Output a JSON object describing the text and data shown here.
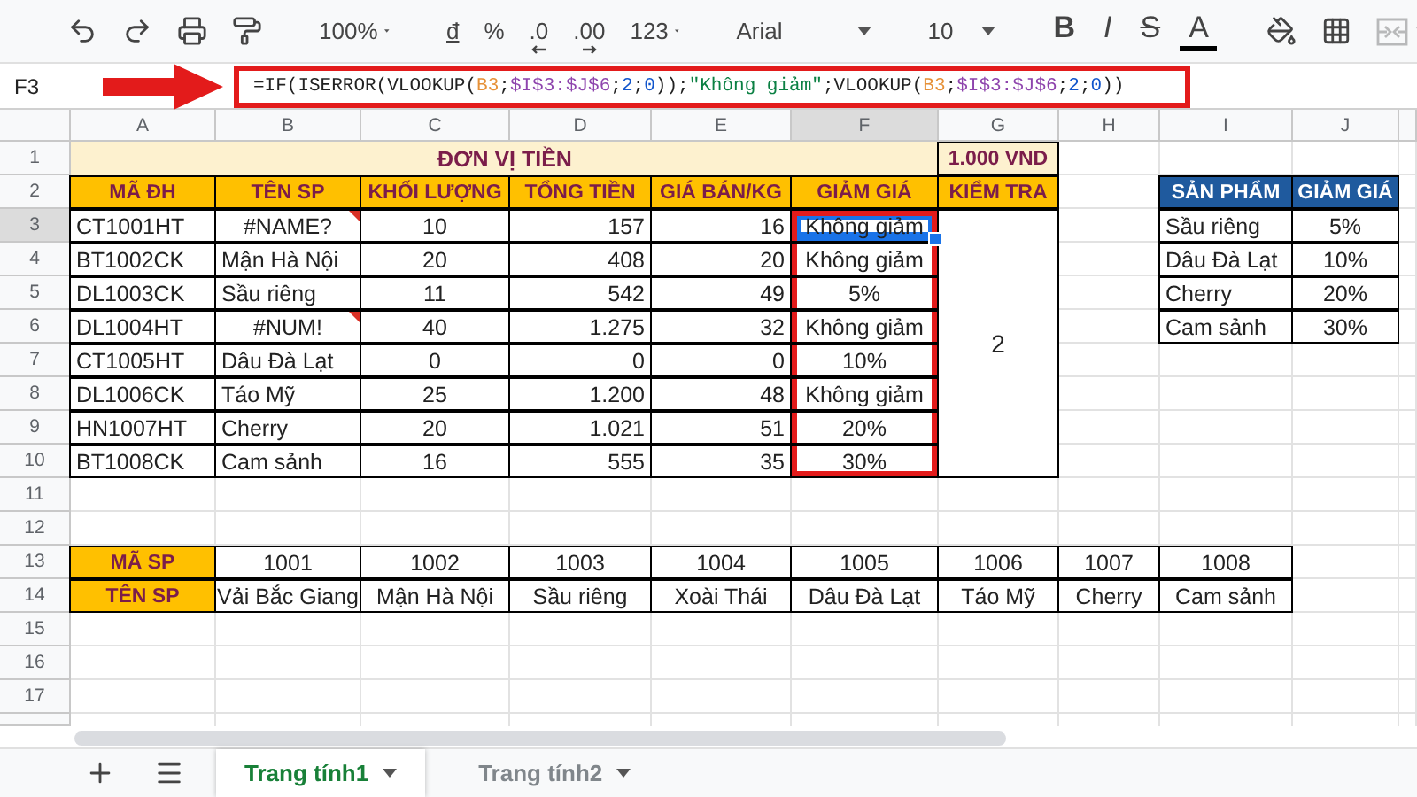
{
  "toolbar": {
    "zoom": "100%",
    "number_formats": [
      "đ",
      "%",
      ".0",
      ".00"
    ],
    "more_formats": "123",
    "font": "Arial",
    "font_size": "10",
    "text_styles": [
      "B",
      "I",
      "S",
      "A"
    ],
    "merge_disabled": true
  },
  "formula_bar": {
    "cell_ref": "F3",
    "formula": [
      {
        "kind": "text",
        "text": "=IF(ISERROR(VLOOKUP("
      },
      {
        "kind": "ref_a",
        "text": "B3"
      },
      {
        "kind": "text",
        "text": ";"
      },
      {
        "kind": "ref_b",
        "text": "$I$3:$J$6"
      },
      {
        "kind": "text",
        "text": ";"
      },
      {
        "kind": "number",
        "text": "2"
      },
      {
        "kind": "text",
        "text": ";"
      },
      {
        "kind": "number",
        "text": "0"
      },
      {
        "kind": "text",
        "text": "));"
      },
      {
        "kind": "string",
        "text": "\"Không giảm\""
      },
      {
        "kind": "text",
        "text": ";VLOOKUP("
      },
      {
        "kind": "ref_a",
        "text": "B3"
      },
      {
        "kind": "text",
        "text": ";"
      },
      {
        "kind": "ref_b",
        "text": "$I$3:$J$6"
      },
      {
        "kind": "text",
        "text": ";"
      },
      {
        "kind": "number",
        "text": "2"
      },
      {
        "kind": "text",
        "text": ";"
      },
      {
        "kind": "number",
        "text": "0"
      },
      {
        "kind": "text",
        "text": "))"
      }
    ]
  },
  "column_headers": [
    {
      "label": "A",
      "selected": false
    },
    {
      "label": "B",
      "selected": false
    },
    {
      "label": "C",
      "selected": false
    },
    {
      "label": "D",
      "selected": false
    },
    {
      "label": "E",
      "selected": false
    },
    {
      "label": "F",
      "selected": true
    },
    {
      "label": "G",
      "selected": false
    },
    {
      "label": "H",
      "selected": false
    },
    {
      "label": "I",
      "selected": false
    },
    {
      "label": "J",
      "selected": false
    }
  ],
  "row_numbers": [
    {
      "label": "1",
      "selected": false
    },
    {
      "label": "2",
      "selected": false
    },
    {
      "label": "3",
      "selected": true
    },
    {
      "label": "4",
      "selected": false
    },
    {
      "label": "5",
      "selected": false
    },
    {
      "label": "6",
      "selected": false
    },
    {
      "label": "7",
      "selected": false
    },
    {
      "label": "8",
      "selected": false
    },
    {
      "label": "9",
      "selected": false
    },
    {
      "label": "10",
      "selected": false
    },
    {
      "label": "11",
      "selected": false
    },
    {
      "label": "12",
      "selected": false
    },
    {
      "label": "13",
      "selected": false
    },
    {
      "label": "14",
      "selected": false
    },
    {
      "label": "15",
      "selected": false
    },
    {
      "label": "16",
      "selected": false
    },
    {
      "label": "17",
      "selected": false
    }
  ],
  "main_table": {
    "title": "ĐƠN VỊ TIỀN",
    "unit": "1.000 VND",
    "headers": [
      "MÃ ĐH",
      "TÊN SP",
      "KHỐI LƯỢNG",
      "TỔNG TIỀN",
      "GIÁ BÁN/KG",
      "GIẢM GIÁ",
      "KIỂM TRA"
    ],
    "check_value": "2",
    "rows": [
      {
        "code": "CT1001HT",
        "product": "#NAME?",
        "error": true,
        "weight": "10",
        "total": "157",
        "price": "16",
        "discount": "Không giảm",
        "selected": true
      },
      {
        "code": "BT1002CK",
        "product": "Mận Hà Nội",
        "error": false,
        "weight": "20",
        "total": "408",
        "price": "20",
        "discount": "Không giảm",
        "selected": false
      },
      {
        "code": "DL1003CK",
        "product": "Sầu riêng",
        "error": false,
        "weight": "11",
        "total": "542",
        "price": "49",
        "discount": "5%",
        "selected": false
      },
      {
        "code": "DL1004HT",
        "product": "#NUM!",
        "error": true,
        "weight": "40",
        "total": "1.275",
        "price": "32",
        "discount": "Không giảm",
        "selected": false
      },
      {
        "code": "CT1005HT",
        "product": "Dâu Đà Lạt",
        "error": false,
        "weight": "0",
        "total": "0",
        "price": "0",
        "discount": "10%",
        "selected": false
      },
      {
        "code": "DL1006CK",
        "product": "Táo Mỹ",
        "error": false,
        "weight": "25",
        "total": "1.200",
        "price": "48",
        "discount": "Không giảm",
        "selected": false
      },
      {
        "code": "HN1007HT",
        "product": "Cherry",
        "error": false,
        "weight": "20",
        "total": "1.021",
        "price": "51",
        "discount": "20%",
        "selected": false
      },
      {
        "code": "BT1008CK",
        "product": "Cam sảnh",
        "error": false,
        "weight": "16",
        "total": "555",
        "price": "35",
        "discount": "30%",
        "selected": false
      }
    ]
  },
  "lookup_table": {
    "headers": [
      "SẢN PHẨM",
      "GIẢM GIÁ"
    ],
    "rows": [
      [
        "Sầu riêng",
        "5%"
      ],
      [
        "Dâu Đà Lạt",
        "10%"
      ],
      [
        "Cherry",
        "20%"
      ],
      [
        "Cam sảnh",
        "30%"
      ]
    ]
  },
  "product_table": {
    "labels": [
      "MÃ SP",
      "TÊN SP"
    ],
    "codes": [
      "1001",
      "1002",
      "1003",
      "1004",
      "1005",
      "1006",
      "1007",
      "1008"
    ],
    "names": [
      "Vải Bắc Giang",
      "Mận Hà Nội",
      "Sầu riêng",
      "Xoài Thái",
      "Dâu Đà Lạt",
      "Táo Mỹ",
      "Cherry",
      "Cam sảnh"
    ]
  },
  "sheet_tabs": [
    {
      "label": "Trang tính1",
      "selected": true
    },
    {
      "label": "Trang tính2",
      "selected": false
    }
  ]
}
